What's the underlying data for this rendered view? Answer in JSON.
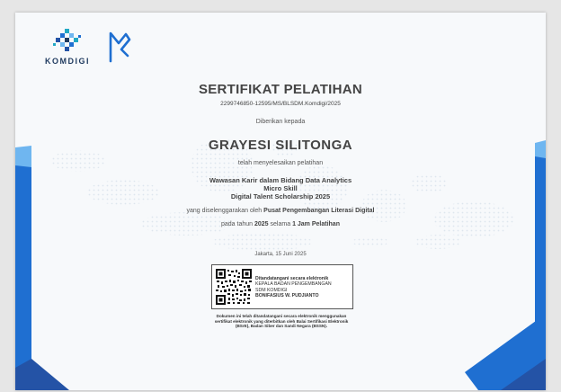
{
  "logo": {
    "text": "KOMDIGI"
  },
  "certificate": {
    "title": "SERTIFIKAT PELATIHAN",
    "number": "2299746850-12595/MS/BLSDM.Komdigi/2025",
    "given_to_label": "Diberikan kepada",
    "recipient": "GRAYESI SILITONGA",
    "completed_label": "telah menyelesaikan pelatihan",
    "course_lines": [
      "Wawasan Karir dalam Bidang Data Analytics",
      "Micro Skill",
      "Digital Talent Scholarship 2025"
    ],
    "organizer_prefix": "yang diselenggarakan oleh",
    "organizer": "Pusat Pengembangan Literasi Digital",
    "period_prefix": "pada tahun",
    "year": "2025",
    "period_mid": "selama",
    "duration": "1 Jam Pelatihan",
    "place_date": "Jakarta, 15 Juni 2025"
  },
  "signature": {
    "line1": "Ditandatangani secara elektronik",
    "line2": "KEPALA BADAN PENGEMBANGAN",
    "line3": "SDM KOMDIGI",
    "line4": "BONIFASIUS W. PUDJIANTO"
  },
  "footer_note": {
    "line1": "Dokumen ini telah ditandatangani secara elektronik menggunakan",
    "line2": "sertifikat elektronik yang diterbitkan oleh Balai Sertifikasi Elektronik",
    "line3": "(BSrE), Badan Siber dan Sandi Negara (BSSN)."
  },
  "colors": {
    "primary_blue": "#1f6fd1",
    "light_blue": "#6fb6f0",
    "teal": "#21a8c4",
    "dark_navy": "#1f3a5f"
  }
}
